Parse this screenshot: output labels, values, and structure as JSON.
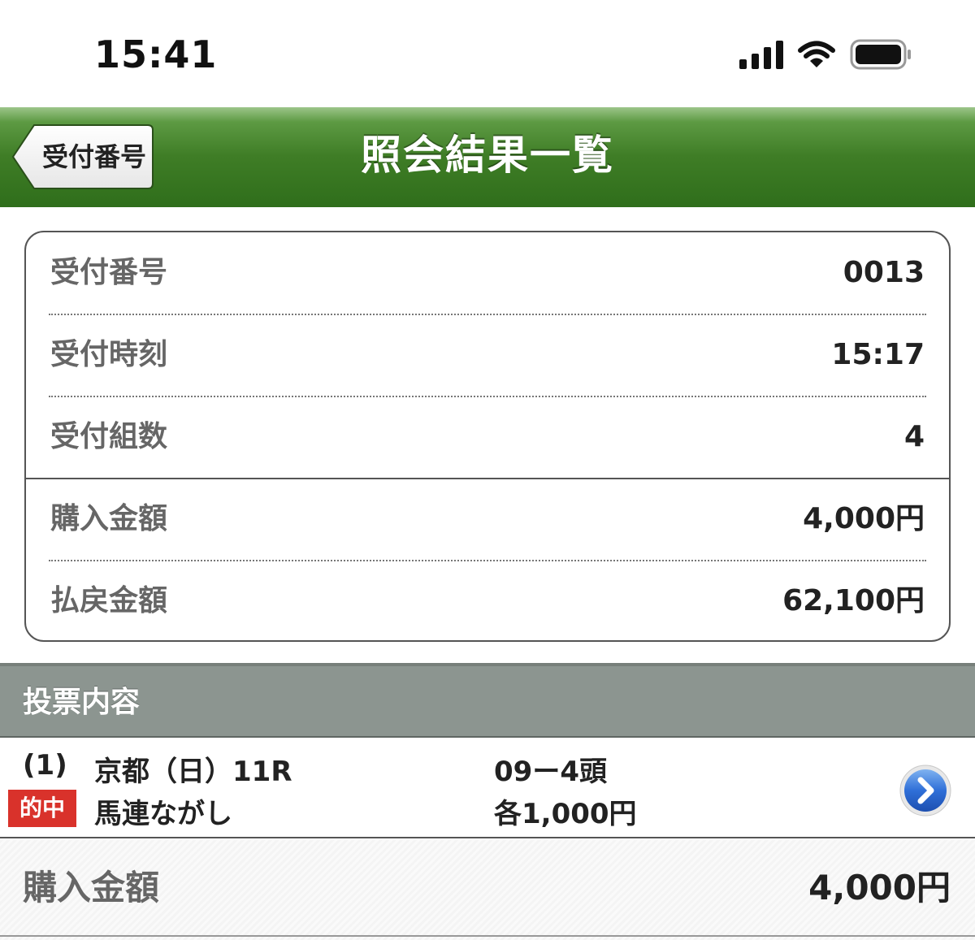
{
  "status_bar": {
    "time": "15:41",
    "icons": [
      "signal-icon",
      "wifi-icon",
      "battery-icon"
    ]
  },
  "nav": {
    "back_label": "受付番号",
    "title": "照会結果一覧",
    "bar_color": "#3f7d26"
  },
  "info": {
    "rows": [
      {
        "label": "受付番号",
        "value": "0013"
      },
      {
        "label": "受付時刻",
        "value": "15:17"
      },
      {
        "label": "受付組数",
        "value": "4"
      },
      {
        "label": "購入金額",
        "value": "4,000円"
      },
      {
        "label": "払戻金額",
        "value": "62,100円"
      }
    ]
  },
  "section": {
    "title": "投票内容"
  },
  "bet": {
    "number": "(1)",
    "venue": "京都（日）11R",
    "badge": "的中",
    "badge_color": "#d9322b",
    "type": "馬連ながし",
    "combination": "09ー4頭",
    "amount": "各1,000円",
    "detail_icon": "chevron-right-icon"
  },
  "total": {
    "label": "購入金額",
    "value": "4,000円"
  }
}
